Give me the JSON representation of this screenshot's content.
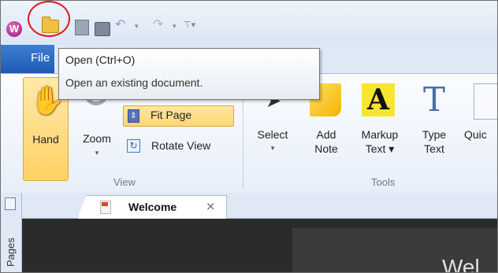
{
  "app": {
    "logo_letter": "W"
  },
  "quick_access": {
    "undo_dropdown": "▾",
    "redo_dropdown": "▾",
    "customize": "⊤▾"
  },
  "file_tab": {
    "label": "File"
  },
  "tooltip": {
    "title": "Open (Ctrl+O)",
    "description": "Open an existing document."
  },
  "ribbon": {
    "hand": {
      "label": "Hand"
    },
    "zoom": {
      "label": "Zoom",
      "dropdown": "▾"
    },
    "fit_page": {
      "label": "Fit Page"
    },
    "rotate_view": {
      "label": "Rotate View"
    },
    "view_group_label": "View",
    "tools": {
      "select": {
        "label": "Select",
        "dropdown": "▾"
      },
      "add_note": {
        "line1": "Add",
        "line2": "Note"
      },
      "markup_text": {
        "line1": "Markup",
        "line2": "Text ▾"
      },
      "type_text": {
        "line1": "Type",
        "line2": "Text"
      },
      "quick": {
        "line1": "Quic"
      }
    },
    "tools_group_label": "Tools"
  },
  "side_panel": {
    "label": "Pages"
  },
  "tabs": [
    {
      "label": "Welcome",
      "close": "×"
    }
  ],
  "document": {
    "heading_partial": "Wel"
  },
  "colors": {
    "accent": "#1f5bb3",
    "highlight": "#ffd166",
    "annotation_circle": "#e0161b"
  }
}
